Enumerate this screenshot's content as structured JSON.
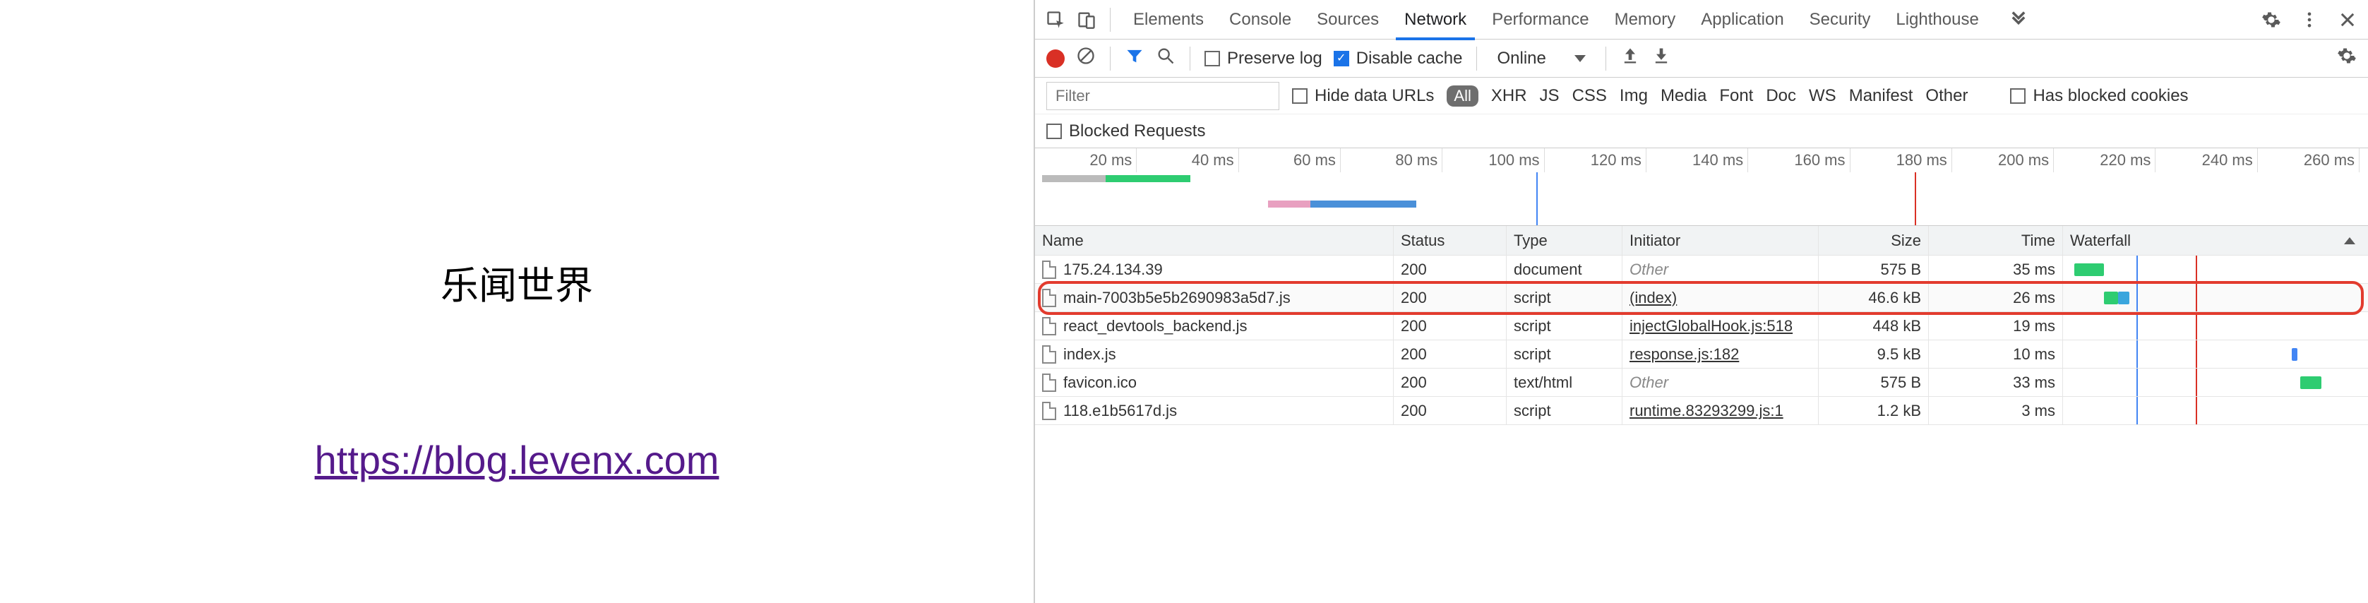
{
  "left": {
    "title": "乐闻世界",
    "link": "https://blog.levenx.com"
  },
  "tabs": [
    "Elements",
    "Console",
    "Sources",
    "Network",
    "Performance",
    "Memory",
    "Application",
    "Security",
    "Lighthouse"
  ],
  "active_tab": "Network",
  "toolbar": {
    "preserve_log": "Preserve log",
    "disable_cache": "Disable cache",
    "throttle": "Online"
  },
  "filter": {
    "placeholder": "Filter",
    "hide_data_urls": "Hide data URLs",
    "all": "All",
    "types": [
      "XHR",
      "JS",
      "CSS",
      "Img",
      "Media",
      "Font",
      "Doc",
      "WS",
      "Manifest",
      "Other"
    ],
    "has_blocked": "Has blocked cookies"
  },
  "blocked": {
    "label": "Blocked Requests"
  },
  "timeline": {
    "ticks": [
      "20 ms",
      "40 ms",
      "60 ms",
      "80 ms",
      "100 ms",
      "120 ms",
      "140 ms",
      "160 ms",
      "180 ms",
      "200 ms",
      "220 ms",
      "240 ms",
      "260 ms"
    ]
  },
  "table": {
    "headers": {
      "name": "Name",
      "status": "Status",
      "type": "Type",
      "initiator": "Initiator",
      "size": "Size",
      "time": "Time",
      "waterfall": "Waterfall"
    },
    "rows": [
      {
        "name": "175.24.134.39",
        "status": "200",
        "type": "document",
        "initiator": "Other",
        "initiator_other": true,
        "size": "575 B",
        "time": "35 ms"
      },
      {
        "name": "main-7003b5e5b2690983a5d7.js",
        "status": "200",
        "type": "script",
        "initiator": "(index)",
        "initiator_other": false,
        "size": "46.6 kB",
        "time": "26 ms",
        "hl": true
      },
      {
        "name": "react_devtools_backend.js",
        "status": "200",
        "type": "script",
        "initiator": "injectGlobalHook.js:518",
        "initiator_other": false,
        "size": "448 kB",
        "time": "19 ms"
      },
      {
        "name": "index.js",
        "status": "200",
        "type": "script",
        "initiator": "response.js:182",
        "initiator_other": false,
        "size": "9.5 kB",
        "time": "10 ms"
      },
      {
        "name": "favicon.ico",
        "status": "200",
        "type": "text/html",
        "initiator": "Other",
        "initiator_other": true,
        "size": "575 B",
        "time": "33 ms"
      },
      {
        "name": "118.e1b5617d.js",
        "status": "200",
        "type": "script",
        "initiator": "runtime.83293299.js:1",
        "initiator_other": false,
        "size": "1.2 kB",
        "time": "3 ms"
      }
    ]
  }
}
